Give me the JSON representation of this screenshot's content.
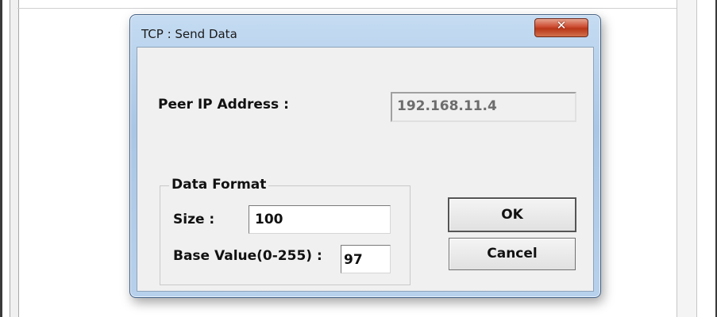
{
  "dialog": {
    "title": "TCP : Send Data",
    "close_icon": "close-x-icon",
    "peer_ip_label": "Peer IP Address :",
    "peer_ip_value": "192.168.11.4",
    "data_format": {
      "group_label": "Data Format",
      "size_label": "Size :",
      "size_value": "100",
      "base_value_label": "Base Value(0-255) :",
      "base_value": "97"
    },
    "ok_label": "OK",
    "cancel_label": "Cancel"
  },
  "colors": {
    "title_bar": "#b7d1ec",
    "close_button": "#cc4b30",
    "client_background": "#f0f0f0"
  }
}
